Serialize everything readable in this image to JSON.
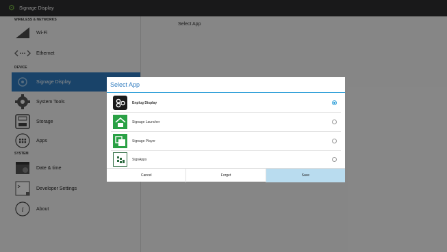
{
  "titlebar": {
    "title": "Signage Display",
    "icon": "gear-icon"
  },
  "sections": {
    "wireless": "WIRELESS & NETWORKS",
    "device": "DEVICE",
    "system": "SYSTEM"
  },
  "items": {
    "wifi": "Wi-Fi",
    "ethernet": "Ethernet",
    "signage": "Signage Display",
    "tools": "System Tools",
    "storage": "Storage",
    "apps": "Apps",
    "datetime": "Date & time",
    "developer": "Developer Settings",
    "about": "About"
  },
  "right_header": "Select App",
  "dialog": {
    "title": "Select App",
    "options": [
      {
        "label": "Enplug Display",
        "selected": true
      },
      {
        "label": "Signage Launcher",
        "selected": false
      },
      {
        "label": "Signage Player",
        "selected": false
      },
      {
        "label": "SignApps",
        "selected": false
      }
    ],
    "cancel": "Cancel",
    "forget": "Forget",
    "save": "Save"
  },
  "colors": {
    "accent": "#2f7bbf",
    "titlebar": "#2f2f31",
    "save_bg": "#b9dcef"
  }
}
